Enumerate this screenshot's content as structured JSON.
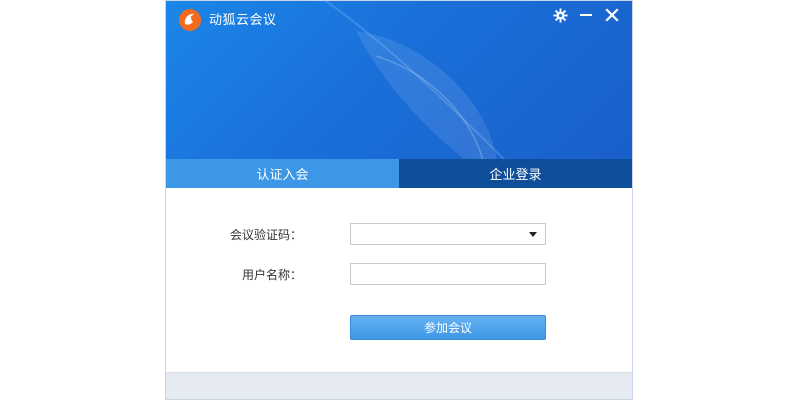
{
  "window": {
    "title": "动狐云会议",
    "settings_icon": "gear-icon",
    "minimize_icon": "minimize-icon",
    "close_icon": "close-icon"
  },
  "tabs": [
    {
      "label": "认证入会",
      "active": true
    },
    {
      "label": "企业登录",
      "active": false
    }
  ],
  "form": {
    "code_label": "会议验证码：",
    "code_value": "",
    "name_label": "用户名称：",
    "name_value": "",
    "join_button": "参加会议"
  },
  "colors": {
    "header_blue": "#1a6fd9",
    "tab_active": "#3c98e6",
    "tab_inactive": "#0f4f99",
    "button_blue": "#4a9fe8"
  }
}
